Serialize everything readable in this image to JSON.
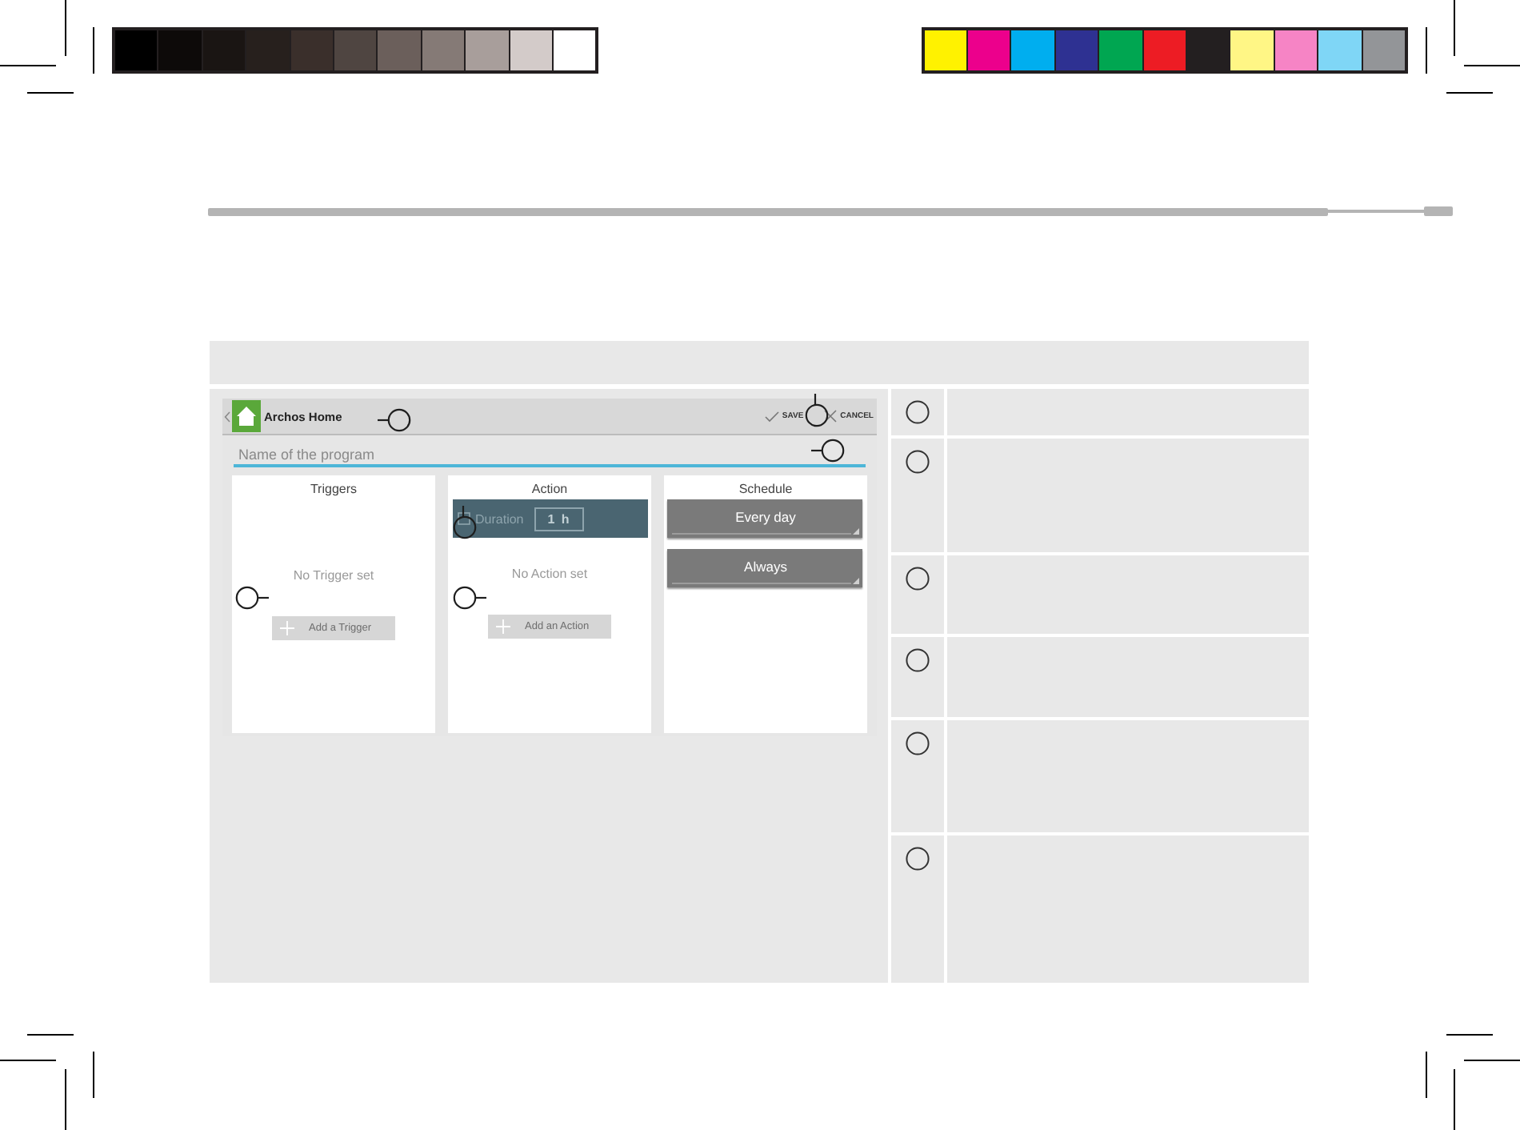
{
  "print_marks": {
    "grayscale_bar": [
      {
        "color": "#000000"
      },
      {
        "color": "#0d0a09"
      },
      {
        "color": "#1a1513"
      },
      {
        "color": "#27201d"
      },
      {
        "color": "#3a2f2b"
      },
      {
        "color": "#4f4541"
      },
      {
        "color": "#6b5f5b"
      },
      {
        "color": "#857a76"
      },
      {
        "color": "#a89e9b"
      },
      {
        "color": "#d3cbc9"
      },
      {
        "color": "#ffffff"
      }
    ],
    "color_bar": [
      {
        "color": "#fff200"
      },
      {
        "color": "#ec008c"
      },
      {
        "color": "#00aeef"
      },
      {
        "color": "#2e3192"
      },
      {
        "color": "#00a651"
      },
      {
        "color": "#ed1c24"
      },
      {
        "color": "#231f20"
      },
      {
        "color": "#fff685"
      },
      {
        "color": "#f684c5"
      },
      {
        "color": "#7fd6f6"
      },
      {
        "color": "#939598"
      }
    ]
  },
  "app_screenshot": {
    "app_bar": {
      "title": "Archos Home",
      "actions": [
        {
          "kind": "save",
          "label": "SAVE"
        },
        {
          "kind": "cancel",
          "label": "CANCEL"
        }
      ]
    },
    "name_field": {
      "placeholder": "Name of the program"
    },
    "panels": [
      {
        "kind": "triggers",
        "title": "Triggers",
        "empty_text": "No Trigger set",
        "add_button": "Add a Trigger"
      },
      {
        "kind": "action",
        "title": "Action",
        "duration": {
          "label": "Duration",
          "value": "1 h",
          "checked": false
        },
        "empty_text": "No Action set",
        "add_button": "Add an Action"
      },
      {
        "kind": "schedule",
        "title": "Schedule",
        "dropdowns": [
          {
            "value": "Every day"
          },
          {
            "value": "Always"
          }
        ]
      }
    ]
  }
}
